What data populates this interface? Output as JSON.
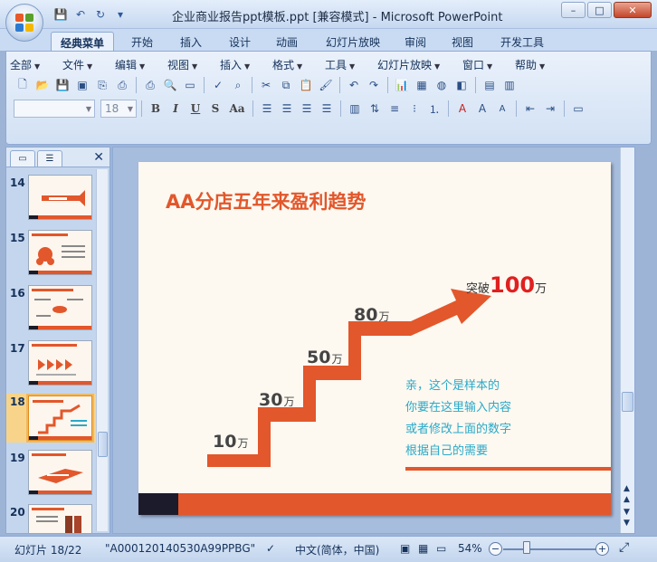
{
  "window": {
    "title": "企业商业报告ppt模板.ppt [兼容模式] - Microsoft PowerPoint",
    "controls": {
      "minimize": "–",
      "restore": "□",
      "close": "✕"
    }
  },
  "quick_access": {
    "save_icon": "💾",
    "undo_icon": "↶",
    "redo_icon": "↻",
    "customize_icon": "▾"
  },
  "ribbon_tabs": [
    "经典菜单",
    "开始",
    "插入",
    "设计",
    "动画",
    "幻灯片放映",
    "审阅",
    "视图",
    "开发工具"
  ],
  "menu_items": [
    "全部",
    "文件",
    "编辑",
    "视图",
    "插入",
    "格式",
    "工具",
    "幻灯片放映",
    "窗口",
    "帮助"
  ],
  "toolbar": {
    "font_name": "",
    "font_size": "18",
    "bold": "B",
    "italic": "I",
    "underline": "U",
    "shadow": "S",
    "change_case": "Aa"
  },
  "slides_panel": {
    "close_icon": "✕",
    "thumbnails": [
      {
        "num": "14",
        "selected": false
      },
      {
        "num": "15",
        "selected": false
      },
      {
        "num": "16",
        "selected": false
      },
      {
        "num": "17",
        "selected": false
      },
      {
        "num": "18",
        "selected": true
      },
      {
        "num": "19",
        "selected": false
      },
      {
        "num": "20",
        "selected": false
      }
    ]
  },
  "slide": {
    "title": "AA分店五年来盈利趋势",
    "steps": [
      {
        "value": "10",
        "unit": "万"
      },
      {
        "value": "30",
        "unit": "万"
      },
      {
        "value": "50",
        "unit": "万"
      },
      {
        "value": "80",
        "unit": "万"
      }
    ],
    "breakthrough": {
      "prefix": "突破",
      "value": "100",
      "unit": "万"
    },
    "sample_text": [
      "亲，这个是样本的",
      "你要在这里输入内容",
      "或者修改上面的数字",
      "根据自己的需要"
    ],
    "colors": {
      "accent": "#e2572b",
      "dark": "#1b1b2b",
      "teal": "#2aa9c9",
      "red": "#e02020"
    }
  },
  "status": {
    "slide_info": "幻灯片 18/22",
    "theme": "\"A000120140530A99PPBG\"",
    "language": "中文(简体，中国)",
    "zoom": "54%",
    "zoom_out": "−",
    "zoom_in": "+"
  }
}
